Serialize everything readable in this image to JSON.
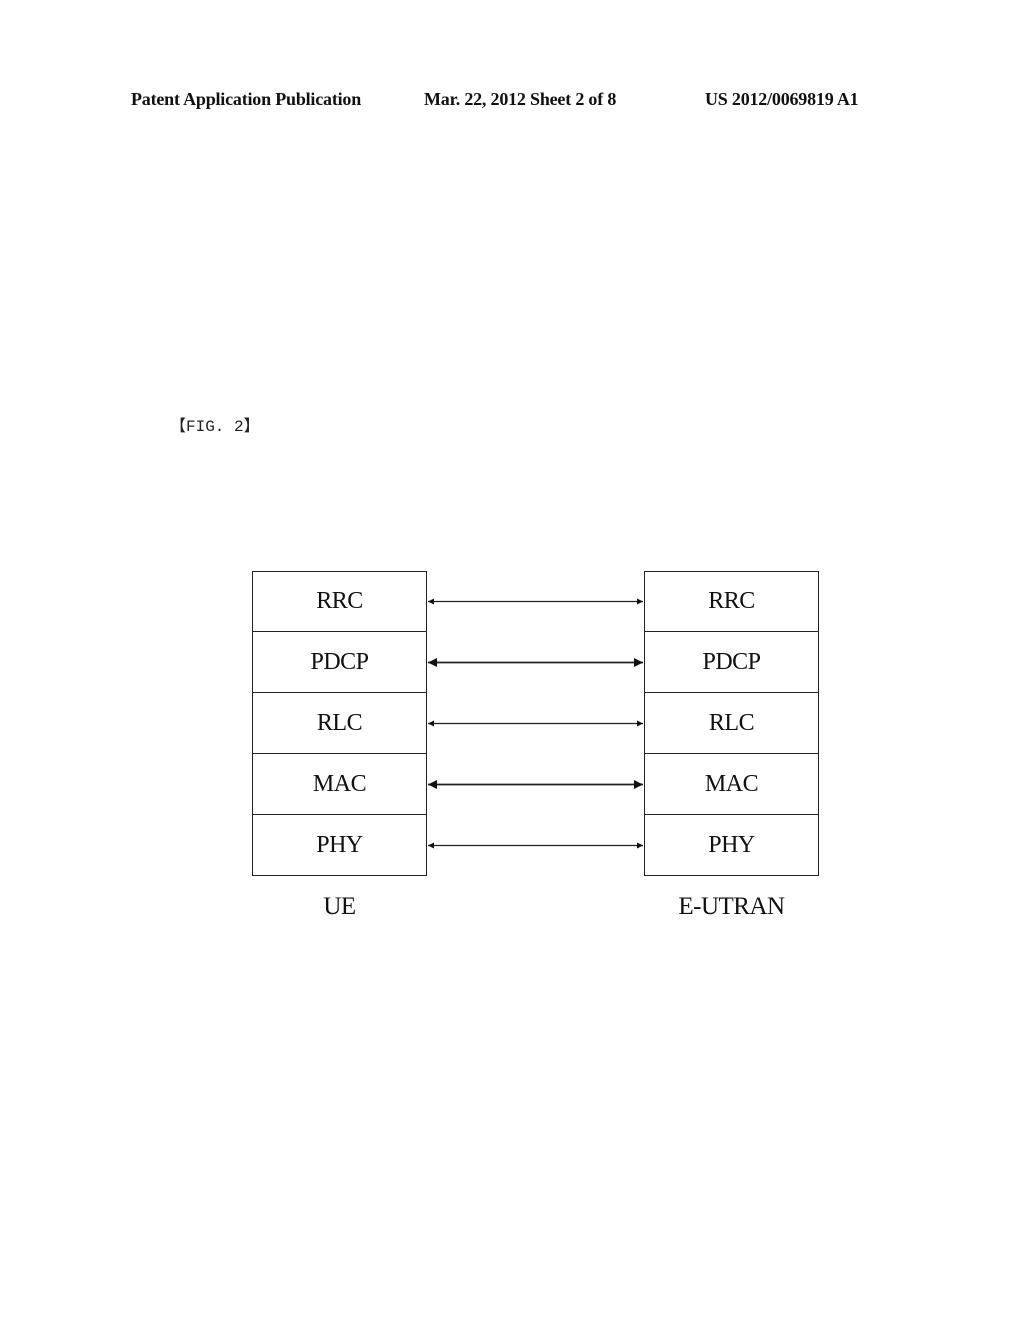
{
  "header": {
    "publication": "Patent Application Publication",
    "date_sheet": "Mar. 22, 2012  Sheet 2 of 8",
    "number": "US 2012/0069819 A1"
  },
  "figure": {
    "label": "【FIG. 2】",
    "left_entity": "UE",
    "right_entity": "E-UTRAN",
    "layers": [
      "RRC",
      "PDCP",
      "RLC",
      "MAC",
      "PHY"
    ],
    "connections": "bidirectional arrow between each peer layer"
  }
}
